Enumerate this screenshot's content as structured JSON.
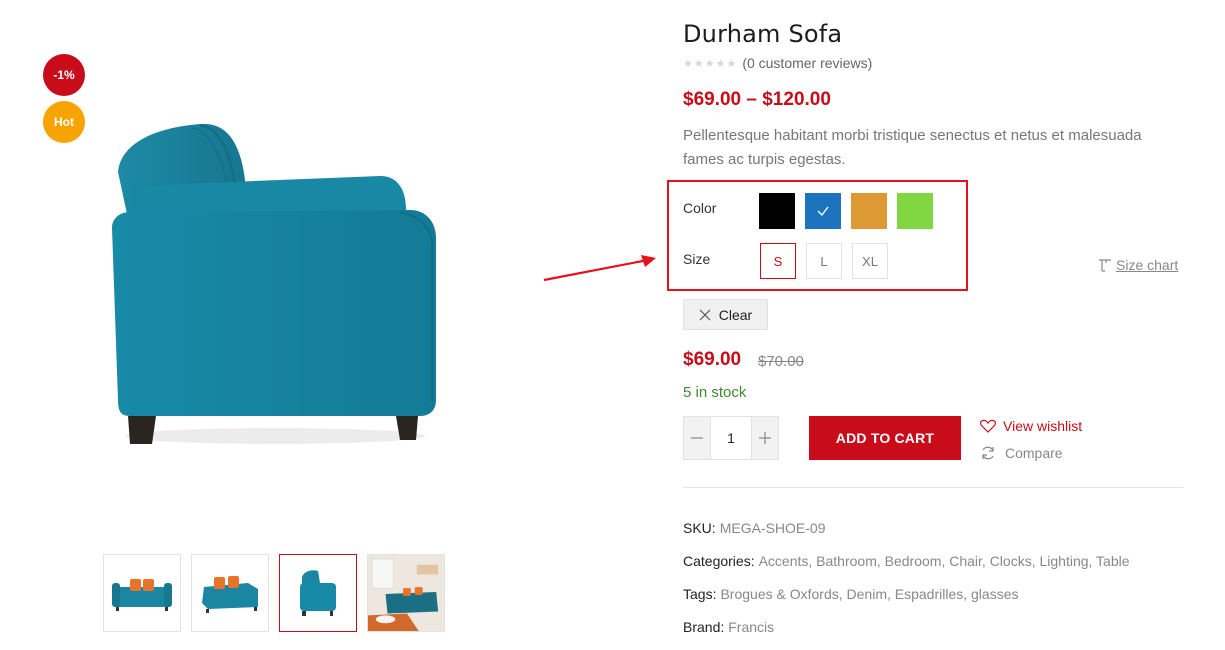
{
  "badges": {
    "sale": "-1%",
    "hot": "Hot"
  },
  "product": {
    "title": "Durham Sofa",
    "rating_stars": "★★★★★",
    "reviews": "(0 customer reviews)",
    "price_range": "$69.00 – $120.00",
    "description": "Pellentesque habitant morbi tristique senectus et netus et malesuada fames ac turpis egestas."
  },
  "variations": {
    "color_label": "Color",
    "size_label": "Size",
    "colors": [
      "#000000",
      "#1e73be",
      "#dd9933",
      "#81d742"
    ],
    "selected_color_index": 1,
    "sizes": [
      "S",
      "L",
      "XL"
    ],
    "selected_size": "S",
    "size_chart": "Size chart",
    "clear": "Clear"
  },
  "pricing": {
    "current": "$69.00",
    "old": "$70.00",
    "stock": "5 in stock"
  },
  "cart": {
    "quantity": "1",
    "add_to_cart": "ADD TO CART",
    "wishlist": "View wishlist",
    "compare": "Compare"
  },
  "meta": {
    "sku_label": "SKU:",
    "sku": "MEGA-SHOE-09",
    "categories_label": "Categories:",
    "categories": "Accents, Bathroom, Bedroom, Chair, Clocks, Lighting, Table",
    "tags_label": "Tags:",
    "tags": "Brogues & Oxfords, Denim, Espadrilles, glasses",
    "brand_label": "Brand:",
    "brand": "Francis"
  },
  "thumbnails": [
    "sofa-front-orange-pillows",
    "sofa-angle-orange-pillows",
    "sofa-side",
    "living-room-scene"
  ],
  "active_thumbnail_index": 2
}
